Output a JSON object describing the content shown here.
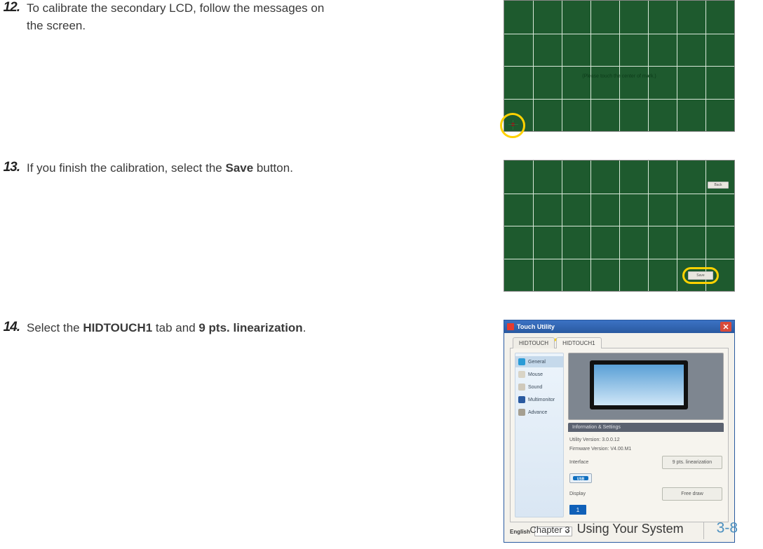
{
  "steps": {
    "s12": {
      "num": "12.",
      "text_a": "To calibrate the secondary LCD, follow the messages on the screen."
    },
    "s13": {
      "num": "13.",
      "text_a": "If you finish the calibration, select the ",
      "bold": "Save",
      "text_b": " button."
    },
    "s14": {
      "num": "14.",
      "text_a": "Select the ",
      "bold1": "HIDTOUCH1",
      "text_b": " tab and ",
      "bold2": "9 pts. linearization",
      "text_c": "."
    }
  },
  "calib": {
    "msg": "(Please touch the center of mark.)",
    "back_btn": "Back",
    "save_btn": "Save"
  },
  "util": {
    "title": "Touch Utility",
    "tabs": {
      "t0": "HIDTOUCH",
      "t1": "HIDTOUCH1"
    },
    "sidebar": {
      "i0": "General",
      "i1": "Mouse",
      "i2": "Sound",
      "i3": "Multimonitor",
      "i4": "Advance"
    },
    "info_header": "Information & Settings",
    "rows": {
      "r0": "Utility Version: 3.0.0.12",
      "r1": "Firmware Version: V4.00.M1",
      "r2": "Interface",
      "r3": "Display"
    },
    "buttons": {
      "lin": "9 pts. linearization",
      "draw": "Free draw"
    },
    "monitor_num": "1",
    "lang_label": "English"
  },
  "footer": {
    "chapter": "Chapter 3",
    "title": "Using Your System",
    "page": "3-8"
  }
}
